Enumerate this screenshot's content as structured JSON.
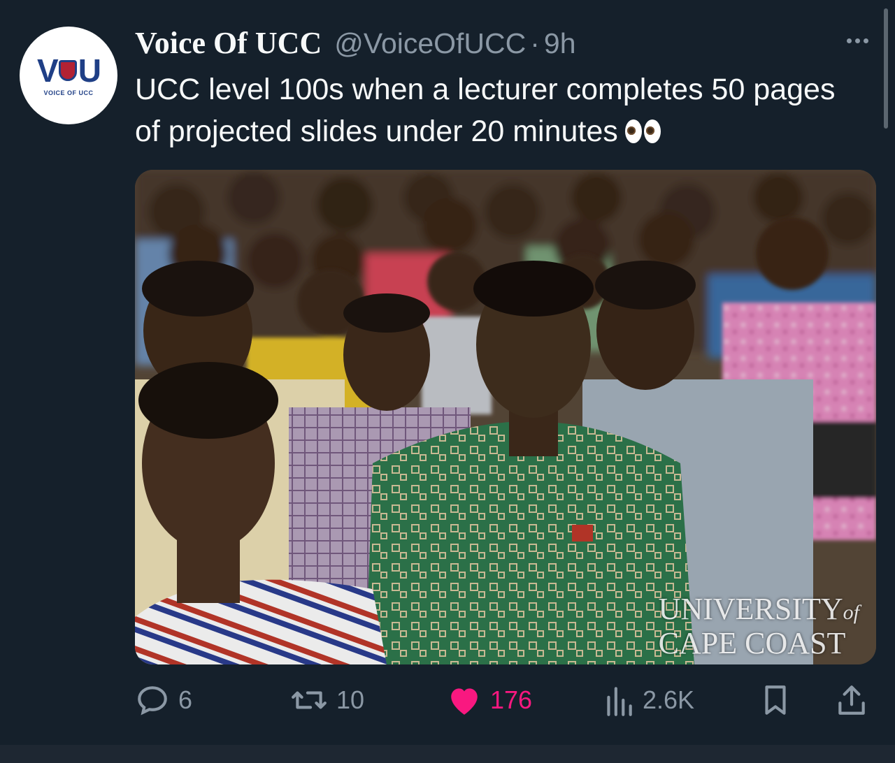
{
  "tweet": {
    "avatar": {
      "logo_text": "VOICE OF UCC"
    },
    "display_name": "Voice Of UCC",
    "handle": "@VoiceOfUCC",
    "separator": "·",
    "time": "9h",
    "text": "UCC level 100s when a lecturer completes 50 pages of projected slides under 20 minutes",
    "emoji": "eyes-emoji",
    "media": {
      "watermark_line1": "UNIVERSITY",
      "watermark_of": "of",
      "watermark_line2": "CAPE COAST"
    }
  },
  "actions": {
    "replies": "6",
    "retweets": "10",
    "likes": "176",
    "views": "2.6K"
  },
  "colors": {
    "background": "#15202b",
    "secondary_text": "#8b98a5",
    "like_pink": "#f91880"
  }
}
